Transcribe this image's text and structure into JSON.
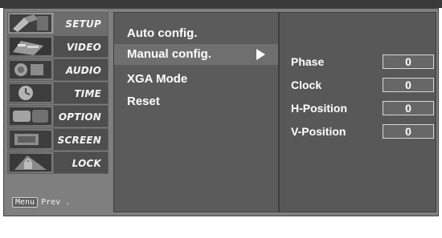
{
  "sidebar": {
    "items": [
      {
        "label": "SETUP"
      },
      {
        "label": "VIDEO"
      },
      {
        "label": "AUDIO"
      },
      {
        "label": "TIME"
      },
      {
        "label": "OPTION"
      },
      {
        "label": "SCREEN"
      },
      {
        "label": "LOCK"
      }
    ],
    "prev": {
      "menu_key": "Menu",
      "label": "Prev ."
    }
  },
  "middle_menu": {
    "items": [
      {
        "label": "Auto config."
      },
      {
        "label": "Manual config."
      },
      {
        "label": "XGA Mode"
      },
      {
        "label": "Reset"
      }
    ],
    "selected": "Manual config."
  },
  "manual_config": {
    "params": [
      {
        "label": "Phase",
        "value": "0"
      },
      {
        "label": "Clock",
        "value": "0"
      },
      {
        "label": "H-Position",
        "value": "0"
      },
      {
        "label": "V-Position",
        "value": "0"
      }
    ]
  },
  "icons": {
    "sidebar_icons": [
      "setup-icon",
      "video-icon",
      "audio-icon",
      "time-icon",
      "option-icon",
      "screen-icon",
      "lock-icon"
    ],
    "submenu_arrow": "right-arrow-icon"
  },
  "colors": {
    "background": "#7f7f7f",
    "panel": "#5b5b5b",
    "text": "#ffffff"
  }
}
